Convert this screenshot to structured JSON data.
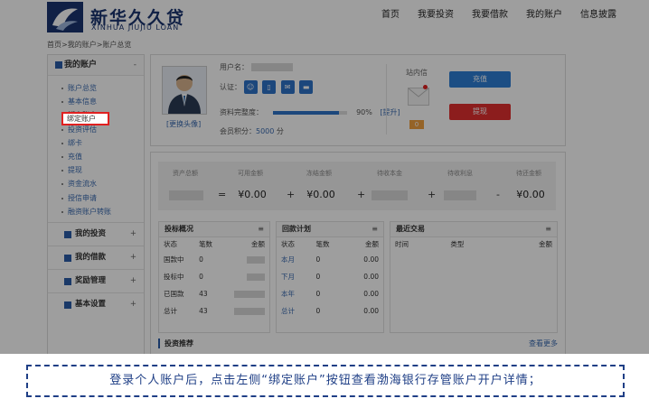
{
  "brand": {
    "name_cn": "新华久久贷",
    "name_en": "XINHUA JIUJIU LOAN"
  },
  "nav": [
    "首页",
    "我要投资",
    "我要借款",
    "我的账户",
    "信息披露"
  ],
  "breadcrumb": "首页>我的账户>账户总览",
  "sidebar": {
    "section_title": "我的账户",
    "section_toggle": "-",
    "items": [
      "账户总览",
      "基本信息",
      "绑定账户",
      "投资评估",
      "绑卡",
      "充值",
      "提现",
      "资金流水",
      "授信申请",
      "融资账户转账"
    ],
    "groups": [
      {
        "label": "我的投资",
        "toggle": "+"
      },
      {
        "label": "我的借款",
        "toggle": "+"
      },
      {
        "label": "奖励管理",
        "toggle": "+"
      },
      {
        "label": "基本设置",
        "toggle": "+"
      }
    ]
  },
  "profile": {
    "username_label": "用户名：",
    "cert_label": "认证：",
    "completeness_label": "资料完整度：",
    "completeness_pct": 90,
    "completeness_text": "90%",
    "improve_link": "[提升]",
    "points_label": "会员积分：",
    "points_value": "5000",
    "points_unit": "分",
    "change_avatar": "[更换头像]",
    "message_title": "站内信",
    "message_count": "0",
    "recharge_button": "充值",
    "withdraw_button": "提现"
  },
  "stats": {
    "headers": [
      "资产总额",
      "可用金额",
      "冻结金额",
      "待收本金",
      "待收利息",
      "待还金额"
    ],
    "values": [
      "",
      "¥0.00",
      "¥0.00",
      "",
      "",
      "¥0.00"
    ],
    "operators": [
      "=",
      "+",
      "+",
      "+",
      "-"
    ]
  },
  "bid_overview": {
    "title": "投标概况",
    "menu_icon": "≡",
    "columns": [
      "状态",
      "笔数",
      "金额"
    ],
    "rows": [
      [
        "国款中",
        "0",
        ""
      ],
      [
        "投标中",
        "0",
        ""
      ],
      [
        "已国款",
        "43",
        ""
      ],
      [
        "总计",
        "43",
        ""
      ]
    ]
  },
  "repay_plan": {
    "title": "回款计划",
    "menu_icon": "≡",
    "columns": [
      "状态",
      "笔数",
      "金额"
    ],
    "rows": [
      [
        "本月",
        "0",
        "0.00"
      ],
      [
        "下月",
        "0",
        "0.00"
      ],
      [
        "本年",
        "0",
        "0.00"
      ],
      [
        "总计",
        "0",
        "0.00"
      ]
    ]
  },
  "recent_trades": {
    "title": "最近交易",
    "menu_icon": "≡",
    "columns": [
      "时间",
      "类型",
      "金额"
    ]
  },
  "invest_recommend": "投资推荐",
  "see_more": "查看更多",
  "caption": "登录个人账户后，点击左侧“绑定账户”按钮查看渤海银行存管账户开户详情；",
  "colors": {
    "brand_blue": "#1a3570",
    "button_blue": "#2e7ed6",
    "button_red": "#e23030",
    "highlight_red": "#e02020",
    "caption_blue": "#1f3f86"
  }
}
